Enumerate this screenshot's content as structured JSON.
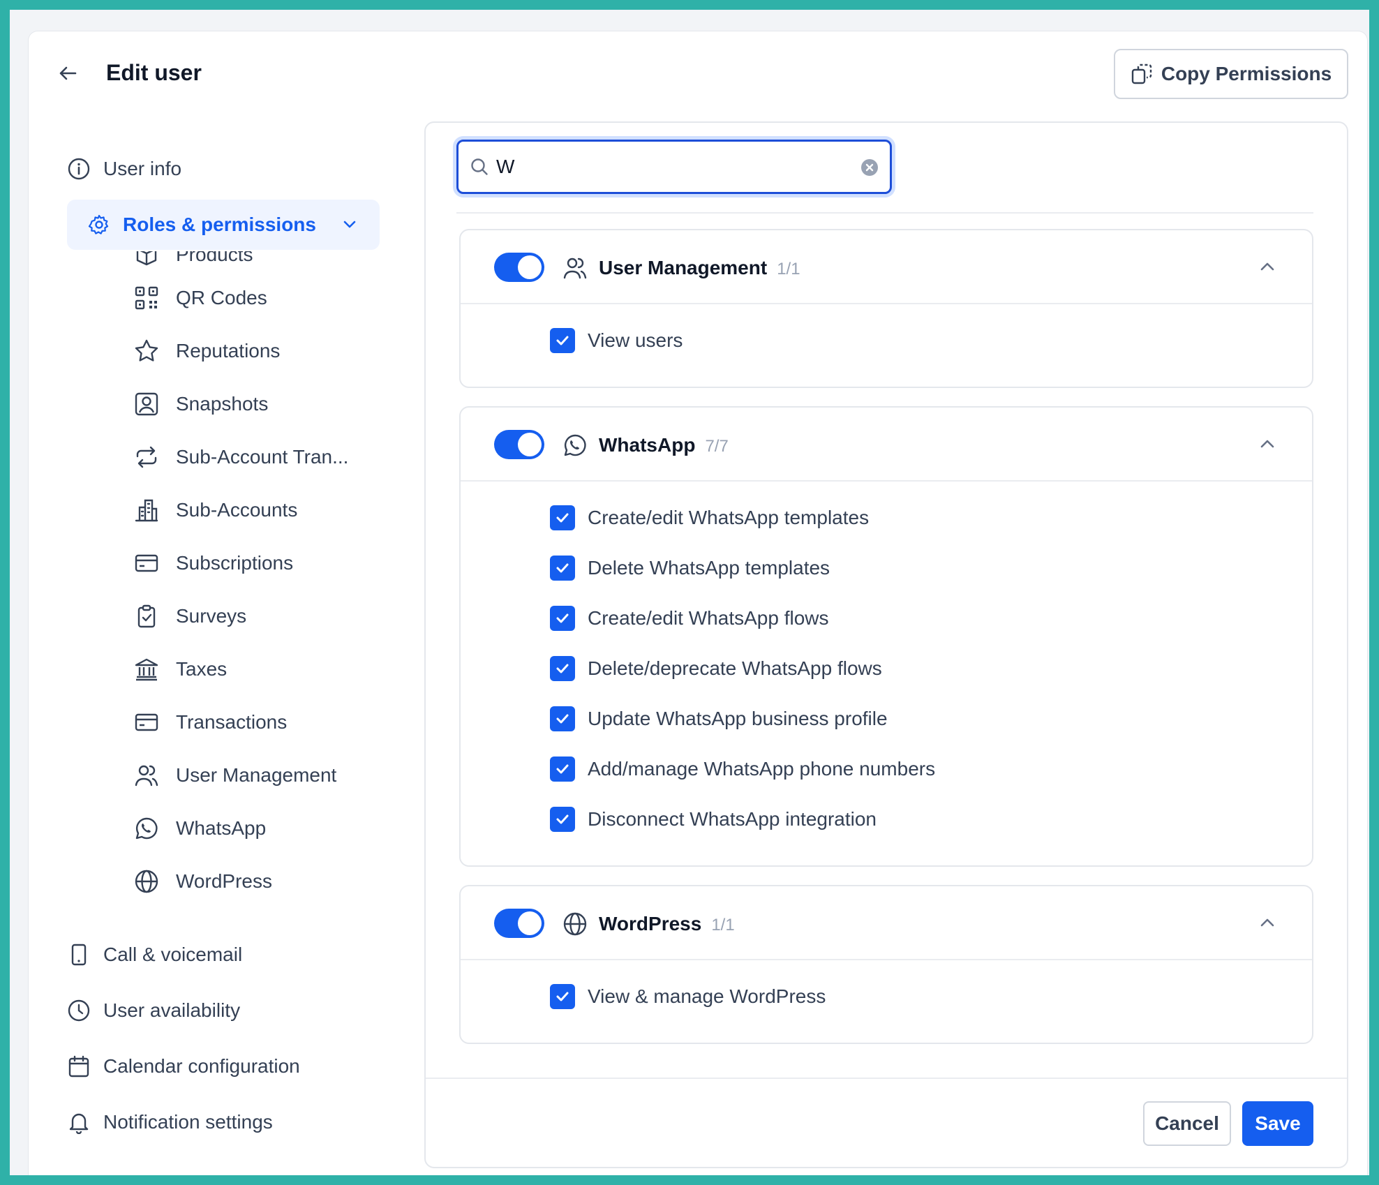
{
  "header": {
    "title": "Edit user",
    "copy_permissions_label": "Copy Permissions"
  },
  "sidebar": {
    "user_info": "User info",
    "roles_permissions": "Roles & permissions",
    "sub_items": [
      {
        "label": "Products",
        "icon": "box-icon"
      },
      {
        "label": "QR Codes",
        "icon": "qr-code-icon"
      },
      {
        "label": "Reputations",
        "icon": "star-icon"
      },
      {
        "label": "Snapshots",
        "icon": "user-square-icon"
      },
      {
        "label": "Sub-Account Tran...",
        "icon": "transfer-icon"
      },
      {
        "label": "Sub-Accounts",
        "icon": "building-icon"
      },
      {
        "label": "Subscriptions",
        "icon": "credit-card-icon"
      },
      {
        "label": "Surveys",
        "icon": "clipboard-check-icon"
      },
      {
        "label": "Taxes",
        "icon": "bank-icon"
      },
      {
        "label": "Transactions",
        "icon": "credit-card-icon"
      },
      {
        "label": "User Management",
        "icon": "users-icon"
      },
      {
        "label": "WhatsApp",
        "icon": "whatsapp-icon"
      },
      {
        "label": "WordPress",
        "icon": "globe-icon"
      }
    ],
    "call_voicemail": "Call & voicemail",
    "user_availability": "User availability",
    "calendar_configuration": "Calendar configuration",
    "notification_settings": "Notification settings"
  },
  "search": {
    "value": "W",
    "placeholder": "Search"
  },
  "groups": [
    {
      "title": "User Management",
      "count": "1/1",
      "enabled": true,
      "permissions": [
        "View users"
      ]
    },
    {
      "title": "WhatsApp",
      "count": "7/7",
      "enabled": true,
      "permissions": [
        "Create/edit WhatsApp templates",
        "Delete WhatsApp templates",
        "Create/edit WhatsApp flows",
        "Delete/deprecate WhatsApp flows",
        "Update WhatsApp business profile",
        "Add/manage WhatsApp phone numbers",
        "Disconnect WhatsApp integration"
      ]
    },
    {
      "title": "WordPress",
      "count": "1/1",
      "enabled": true,
      "permissions": [
        "View & manage WordPress"
      ]
    }
  ],
  "footer": {
    "cancel_label": "Cancel",
    "save_label": "Save"
  },
  "colors": {
    "accent": "#155eef",
    "background_border": "#2fb1a8",
    "active_nav_bg": "#eff4ff"
  }
}
